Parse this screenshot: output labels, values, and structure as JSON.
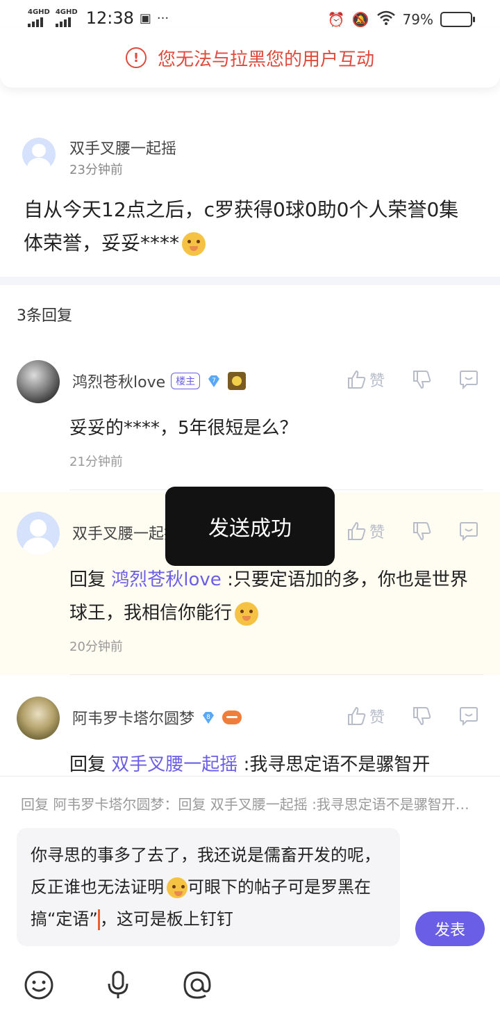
{
  "status_bar": {
    "signal1": "4GHD",
    "signal2": "4GHD",
    "time": "12:38",
    "more": "···",
    "battery": "79%",
    "battery_level": 0.79
  },
  "warning": {
    "icon": "exclamation-circle-icon",
    "text": "您无法与拉黑您的用户互动",
    "color": "#e04a3c"
  },
  "post": {
    "author": "双手叉腰一起摇",
    "time": "23分钟前",
    "content": "自从今天12点之后，c罗获得0球0助0个人荣誉0集体荣誉，妥妥****"
  },
  "reply_count": "3条回复",
  "replies": [
    {
      "author": "鸿烈苍秋love",
      "host_badge": "楼主",
      "level": "7",
      "like_label": "赞",
      "text": "妥妥的****，5年很短是么？",
      "time": "21分钟前"
    },
    {
      "author": "双手叉腰一起摇",
      "like_label": "赞",
      "reply_prefix": "回复",
      "mention": "鸿烈苍秋love",
      "text": ":只要定语加的多，你也是世界球王，我相信你能行",
      "time": "20分钟前"
    },
    {
      "author": "阿韦罗卡塔尔圆梦",
      "level": "8",
      "like_label": "赞",
      "reply_prefix": "回复",
      "mention": "双手叉腰一起摇",
      "text": ":我寻思定语不是骡智开"
    }
  ],
  "toast": "发送成功",
  "composer": {
    "quote": "回复 阿韦罗卡塔尔圆梦：回复 双手叉腰一起摇 :我寻思定语不是骡智开…",
    "input_before": "你寻思的事多了去了，我还说是儒畜开发的呢，反正谁也无法证明",
    "input_mid": "可眼下的帖子可是罗黑在搞“定语”",
    "input_after": "，这可是板上钉钉",
    "send_label": "发表",
    "tools": [
      "smile-icon",
      "microphone-icon",
      "at-icon"
    ]
  },
  "colors": {
    "accent": "#6a5ee6",
    "warning": "#e04a3c",
    "muted": "#999999"
  }
}
